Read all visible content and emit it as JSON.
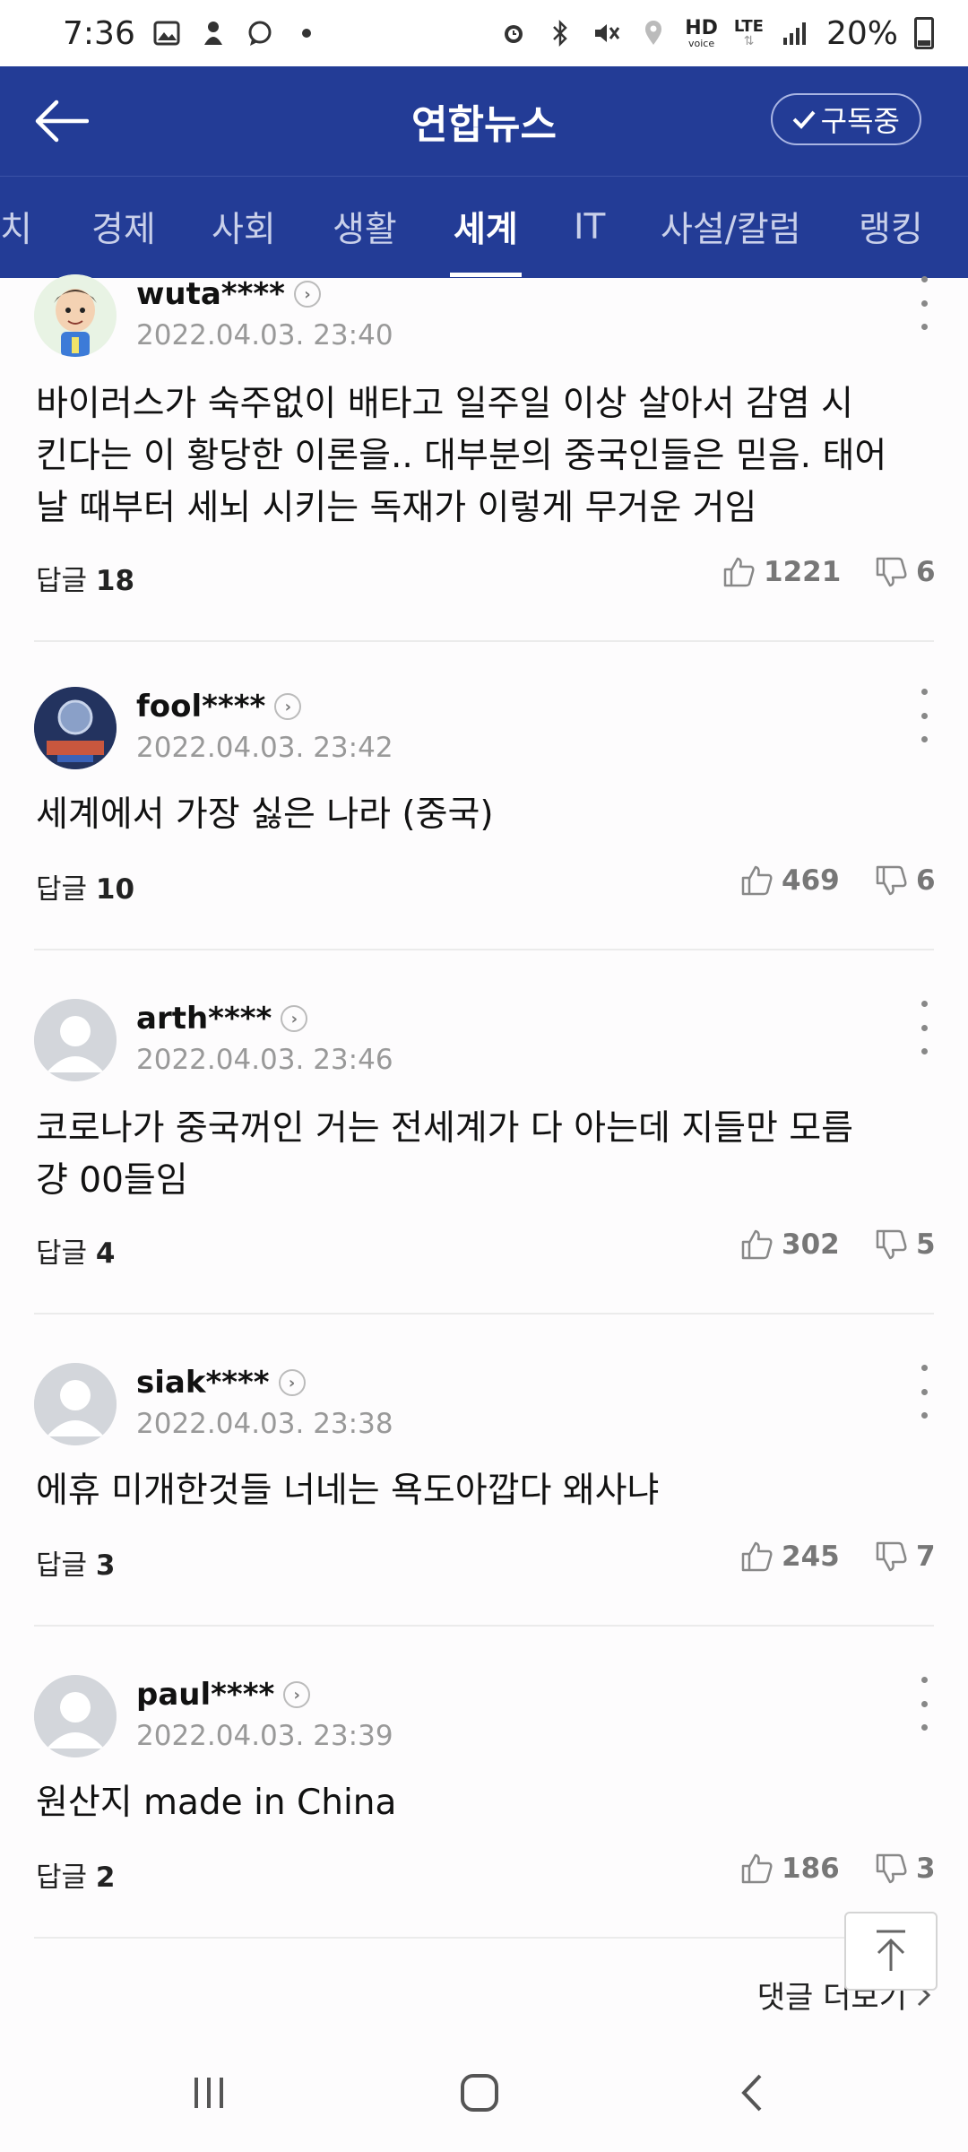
{
  "status_bar": {
    "time": "7:36",
    "battery": "20%",
    "left_icons": [
      "gallery-icon",
      "notification-icon",
      "chat-bubble-icon",
      "dot-icon"
    ],
    "right_icons": [
      "alarm-icon",
      "bluetooth-icon",
      "mute-icon",
      "location-icon",
      "hd-voice-icon",
      "lte-icon",
      "signal-icon",
      "battery-icon"
    ],
    "hd_label": "HD",
    "hd_sub": "voice",
    "lte_label": "LTE"
  },
  "header": {
    "title": "연합뉴스",
    "subscribe_label": "구독중",
    "back_icon": "arrow-left-icon"
  },
  "tabs": [
    {
      "label": "치",
      "active": false
    },
    {
      "label": "경제",
      "active": false
    },
    {
      "label": "사회",
      "active": false
    },
    {
      "label": "생활",
      "active": false
    },
    {
      "label": "세계",
      "active": true
    },
    {
      "label": "IT",
      "active": false
    },
    {
      "label": "사설/칼럼",
      "active": false
    },
    {
      "label": "랭킹",
      "active": false
    }
  ],
  "comments": [
    {
      "user": "wuta****",
      "date": "2022.04.03. 23:40",
      "text_lines": [
        "바이러스가 숙주없이 배타고 일주일 이상 살아서 감염 시",
        "킨다는 이 황당한 이론을.. 대부분의 중국인들은 믿음. 태어",
        "날 때부터 세뇌 시키는 독재가 이렇게 무거운 거임"
      ],
      "reply_label": "답글",
      "reply_count": "18",
      "likes": "1221",
      "dislikes": "6",
      "avatar": "cartoon-avatar"
    },
    {
      "user": "fool****",
      "date": "2022.04.03. 23:42",
      "text_lines": [
        "세계에서 가장 싫은 나라 (중국)"
      ],
      "reply_label": "답글",
      "reply_count": "10",
      "likes": "469",
      "dislikes": "6",
      "avatar": "badge-avatar"
    },
    {
      "user": "arth****",
      "date": "2022.04.03. 23:46",
      "text_lines": [
        "코로나가 중국꺼인 거는 전세계가 다 아는데 지들만 모름",
        "걍 00들임"
      ],
      "reply_label": "답글",
      "reply_count": "4",
      "likes": "302",
      "dislikes": "5",
      "avatar": "default-avatar"
    },
    {
      "user": "siak****",
      "date": "2022.04.03. 23:38",
      "text_lines": [
        "에휴 미개한것들 너네는 욕도아깝다 왜사냐"
      ],
      "reply_label": "답글",
      "reply_count": "3",
      "likes": "245",
      "dislikes": "7",
      "avatar": "default-avatar"
    },
    {
      "user": "paul****",
      "date": "2022.04.03. 23:39",
      "text_lines": [
        "원산지 made in China"
      ],
      "reply_label": "답글",
      "reply_count": "2",
      "likes": "186",
      "dislikes": "3",
      "avatar": "default-avatar"
    }
  ],
  "load_more_label": "댓글 더보기",
  "nav": [
    "recent-apps-icon",
    "home-icon",
    "back-icon"
  ],
  "colors": {
    "header_bg": "#233c96",
    "tab_inactive": "#c9d0ea",
    "muted": "#999999"
  }
}
